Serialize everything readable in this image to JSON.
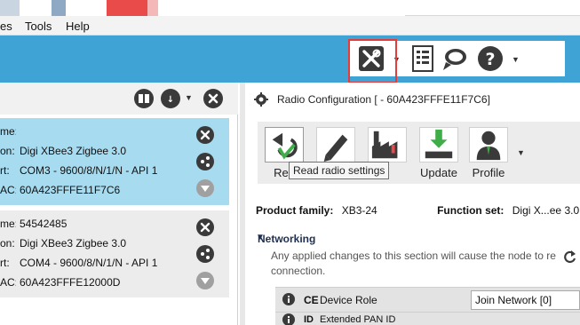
{
  "menu": {
    "items": [
      "es",
      "Tools",
      "Help"
    ]
  },
  "colors": {
    "toolbar": "#3fa3d6",
    "selected_device": "#a7dbf0",
    "highlight": "#e53b3b"
  },
  "toolbar": {
    "icons": [
      "tools-icon",
      "console-icon",
      "chat-icon",
      "help-icon"
    ]
  },
  "devices": [
    {
      "name_label": "me:",
      "name": "",
      "function_label": "on:",
      "function": "Digi XBee3 Zigbee 3.0",
      "port_label": "rt:",
      "port": "COM3 - 9600/8/N/1/N - API 1",
      "mac_label": "AC:",
      "mac": "60A423FFFE11F7C6"
    },
    {
      "name_label": "me:",
      "name": "54542485",
      "function_label": "on:",
      "function": "Digi XBee3 Zigbee 3.0",
      "port_label": "rt:",
      "port": "COM4 - 9600/8/N/1/N - API 1",
      "mac_label": "AC:",
      "mac": "60A423FFFE12000D"
    }
  ],
  "radio_config": {
    "title": "Radio Configuration [  - 60A423FFFE11F7C6]",
    "actions": [
      "Rea",
      "",
      "",
      "Update",
      "Profile"
    ],
    "tooltip": "Read radio settings",
    "product_family_label": "Product family:",
    "product_family": "XB3-24",
    "function_set_label": "Function set:",
    "function_set": "Digi X...ee 3.0",
    "section_title": "Networking",
    "section_desc_1": "Any applied changes to this section will cause the node to re",
    "section_desc_2": "connection.",
    "settings": [
      {
        "code": "CE",
        "name": "Device Role",
        "value": "Join Network [0]"
      },
      {
        "code": "ID",
        "name": "Extended PAN ID",
        "value": ""
      }
    ]
  }
}
